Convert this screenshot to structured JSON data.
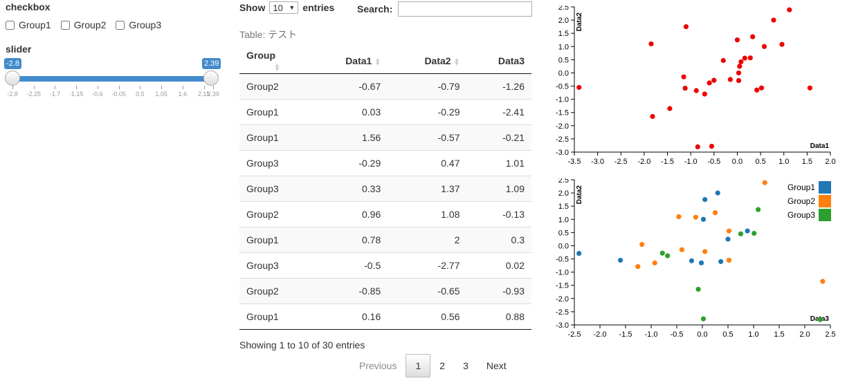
{
  "controls": {
    "checkbox_title": "checkbox",
    "checkboxes": [
      "Group1",
      "Group2",
      "Group3"
    ],
    "slider_title": "slider",
    "slider": {
      "min": -2.8,
      "max": 2.39,
      "from": -2.8,
      "to": 2.39,
      "from_label": "-2.8",
      "to_label": "2.39",
      "ticks": [
        "-2.8",
        "-2.25",
        "-1.7",
        "-1.15",
        "-0.6",
        "-0.05",
        "0.5",
        "1.05",
        "1.6",
        "2.15",
        "2.39"
      ]
    }
  },
  "table": {
    "show_label": "Show",
    "entries_label": "entries",
    "length_value": "10",
    "search_label": "Search:",
    "caption": "Table: テスト",
    "columns": [
      "Group",
      "Data1",
      "Data2",
      "Data3"
    ],
    "rows": [
      [
        "Group2",
        "-0.67",
        "-0.79",
        "-1.26"
      ],
      [
        "Group1",
        "0.03",
        "-0.29",
        "-2.41"
      ],
      [
        "Group1",
        "1.56",
        "-0.57",
        "-0.21"
      ],
      [
        "Group3",
        "-0.29",
        "0.47",
        "1.01"
      ],
      [
        "Group3",
        "0.33",
        "1.37",
        "1.09"
      ],
      [
        "Group2",
        "0.96",
        "1.08",
        "-0.13"
      ],
      [
        "Group1",
        "0.78",
        "2",
        "0.3"
      ],
      [
        "Group3",
        "-0.5",
        "-2.77",
        "0.02"
      ],
      [
        "Group2",
        "-0.85",
        "-0.65",
        "-0.93"
      ],
      [
        "Group1",
        "0.16",
        "0.56",
        "0.88"
      ]
    ],
    "info": "Showing 1 to 10 of 30 entries",
    "pagination": {
      "previous": "Previous",
      "pages": [
        "1",
        "2",
        "3"
      ],
      "current": "1",
      "next": "Next"
    }
  },
  "chart_data": [
    {
      "type": "scatter",
      "title": "",
      "xlabel": "Data1",
      "ylabel": "Data2",
      "xlim": [
        -3.5,
        2.0
      ],
      "ylim": [
        -3.0,
        2.5
      ],
      "xticks": [
        "-3.5",
        "-3.0",
        "-2.5",
        "-2.0",
        "-1.5",
        "-1.0",
        "-0.5",
        "0.0",
        "0.5",
        "1.0",
        "1.5",
        "2.0"
      ],
      "yticks": [
        "2.5",
        "2.0",
        "1.5",
        "1.0",
        "0.5",
        "0.0",
        "-0.5",
        "-1.0",
        "-1.5",
        "-2.0",
        "-2.5",
        "-3.0"
      ],
      "color": "#ee0000",
      "points": [
        [
          -3.4,
          -0.55
        ],
        [
          -1.85,
          1.1
        ],
        [
          -1.82,
          -1.65
        ],
        [
          -1.45,
          -1.35
        ],
        [
          -1.1,
          1.75
        ],
        [
          -1.15,
          -0.15
        ],
        [
          -1.12,
          -0.58
        ],
        [
          -0.88,
          -0.67
        ],
        [
          -0.85,
          -2.8
        ],
        [
          -0.7,
          -0.8
        ],
        [
          -0.6,
          -0.38
        ],
        [
          -0.55,
          -2.78
        ],
        [
          -0.5,
          -0.28
        ],
        [
          -0.3,
          0.47
        ],
        [
          -0.15,
          -0.25
        ],
        [
          0.0,
          1.25
        ],
        [
          0.03,
          -0.29
        ],
        [
          0.03,
          0.0
        ],
        [
          0.05,
          0.25
        ],
        [
          0.08,
          0.42
        ],
        [
          0.16,
          0.56
        ],
        [
          0.28,
          0.57
        ],
        [
          0.33,
          1.37
        ],
        [
          0.42,
          -0.65
        ],
        [
          0.52,
          -0.57
        ],
        [
          0.58,
          1.0
        ],
        [
          0.78,
          2.0
        ],
        [
          0.96,
          1.08
        ],
        [
          1.12,
          2.39
        ],
        [
          1.56,
          -0.57
        ]
      ]
    },
    {
      "type": "scatter",
      "title": "",
      "xlabel": "Data3",
      "ylabel": "Data2",
      "xlim": [
        -2.5,
        2.5
      ],
      "ylim": [
        -3.0,
        2.5
      ],
      "xticks": [
        "-2.5",
        "-2.0",
        "-1.5",
        "-1.0",
        "-0.5",
        "0.0",
        "0.5",
        "1.0",
        "1.5",
        "2.0",
        "2.5"
      ],
      "yticks": [
        "2.5",
        "2.0",
        "1.5",
        "1.0",
        "0.5",
        "0.0",
        "-0.5",
        "-1.0",
        "-1.5",
        "-2.0",
        "-2.5",
        "-3.0"
      ],
      "legend_position": "top-right",
      "series": [
        {
          "name": "Group1",
          "color": "#1f77b4",
          "points": [
            [
              -2.41,
              -0.29
            ],
            [
              -1.6,
              -0.55
            ],
            [
              -0.21,
              -0.57
            ],
            [
              0.02,
              1.0
            ],
            [
              0.05,
              1.75
            ],
            [
              0.3,
              2.0
            ],
            [
              0.36,
              -0.6
            ],
            [
              0.5,
              0.25
            ],
            [
              0.88,
              0.56
            ],
            [
              -0.02,
              -0.65
            ]
          ]
        },
        {
          "name": "Group2",
          "color": "#ff7f0e",
          "points": [
            [
              -1.26,
              -0.79
            ],
            [
              -1.18,
              0.05
            ],
            [
              -0.93,
              -0.65
            ],
            [
              -0.46,
              1.1
            ],
            [
              -0.4,
              -0.15
            ],
            [
              -0.13,
              1.08
            ],
            [
              0.05,
              -0.22
            ],
            [
              0.25,
              1.25
            ],
            [
              0.52,
              -0.55
            ],
            [
              0.52,
              0.56
            ],
            [
              1.22,
              2.39
            ],
            [
              2.35,
              -1.35
            ]
          ]
        },
        {
          "name": "Group3",
          "color": "#2ca02c",
          "points": [
            [
              -0.78,
              -0.28
            ],
            [
              -0.68,
              -0.38
            ],
            [
              -0.08,
              -1.65
            ],
            [
              0.02,
              -2.77
            ],
            [
              0.75,
              0.45
            ],
            [
              1.01,
              0.47
            ],
            [
              1.09,
              1.37
            ],
            [
              2.3,
              -2.8
            ]
          ]
        }
      ]
    }
  ]
}
